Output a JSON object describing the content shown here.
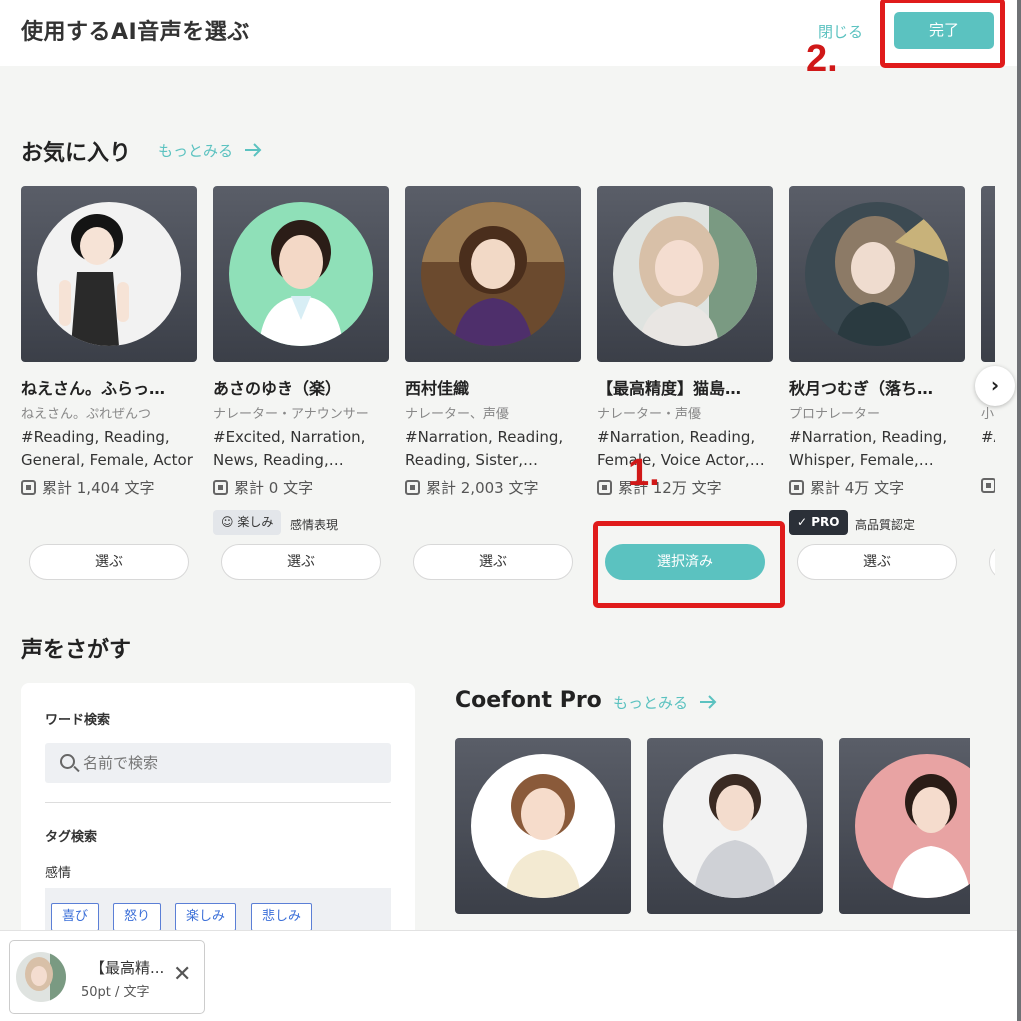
{
  "header": {
    "title": "使用するAI音声を選ぶ",
    "close_label": "閉じる",
    "done_label": "完了"
  },
  "annotations": {
    "step1": "1.",
    "step2": "2."
  },
  "favorites": {
    "title": "お気に入り",
    "more_label": "もっとみる",
    "cards": [
      {
        "name": "ねえさん。ふらっ…",
        "role": "ねえさん。ぷれぜんつ",
        "tags": "#Reading, Reading, General, Female, Actor",
        "count": "累計 1,404 文字",
        "badge": "",
        "badge_after": "",
        "button": "選ぶ",
        "selected": false
      },
      {
        "name": "あさのゆき（楽）",
        "role": "ナレーター・アナウンサー",
        "tags": "#Excited, Narration, News, Reading,…",
        "count": "累計 0 文字",
        "badge": "楽しみ",
        "badge_after": "感情表現",
        "button": "選ぶ",
        "selected": false
      },
      {
        "name": "西村佳織",
        "role": "ナレーター、声優",
        "tags": "#Narration, Reading, Reading, Sister,…",
        "count": "累計 2,003 文字",
        "badge": "",
        "badge_after": "",
        "button": "選ぶ",
        "selected": false
      },
      {
        "name": "【最高精度】猫島…",
        "role": "ナレーター・声優",
        "tags": "#Narration, Reading, Female, Voice Actor,…",
        "count": "累計 12万 文字",
        "badge": "",
        "badge_after": "",
        "button": "選択済み",
        "selected": true
      },
      {
        "name": "秋月つむぎ（落ち…",
        "role": "プロナレーター",
        "tags": "#Narration, Reading, Whisper, Female,…",
        "count": "累計 4万 文字",
        "badge": "PRO",
        "badge_after": "高品質認定",
        "button": "選ぶ",
        "selected": false
      },
      {
        "name": "",
        "role": "小",
        "tags": "#A W",
        "count": "",
        "badge": "",
        "badge_after": "",
        "button": "",
        "selected": false
      }
    ]
  },
  "search": {
    "title": "声をさがす",
    "word_label": "ワード検索",
    "placeholder": "名前で検索",
    "tag_label": "タグ検索",
    "emotion_label": "感情",
    "emotion_tags": [
      "喜び",
      "怒り",
      "楽しみ",
      "悲しみ"
    ]
  },
  "coefont_pro": {
    "title": "Coefont Pro",
    "more_label": "もっとみる"
  },
  "selected_voice": {
    "name": "【最高精...",
    "price": "50pt / 文字"
  },
  "colors": {
    "accent": "#5bc2c0",
    "highlight": "#e01b1b",
    "pro_badge": "#2b3038"
  },
  "icons": {
    "more_arrow": "arrow-right-icon",
    "count": "voice-count-icon",
    "next": "chevron-right-icon",
    "search": "search-icon",
    "close": "close-icon",
    "emotion": "smile-icon",
    "pro": "check-badge-icon"
  }
}
